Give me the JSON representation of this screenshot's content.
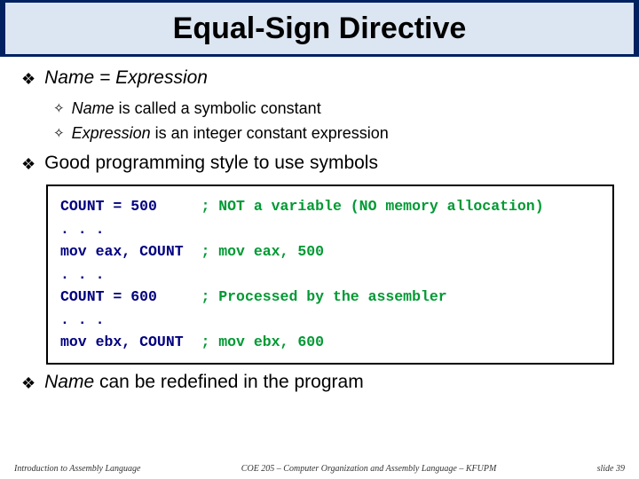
{
  "title": "Equal-Sign Directive",
  "bullets": {
    "b1_prefix": "Name = Expression",
    "b1_sub1_before": "Name",
    "b1_sub1_after": " is called a symbolic constant",
    "b1_sub2_before": "Expression",
    "b1_sub2_after": " is an integer constant expression",
    "b2": "Good programming style to use symbols",
    "b3_before": "Name",
    "b3_after": " can be redefined in the program"
  },
  "code": {
    "l1a": "COUNT = 500     ",
    "l1b": "; NOT a variable (NO memory allocation)",
    "l2": ". . .",
    "l3a": "mov eax, COUNT  ",
    "l3b": "; mov eax, 500",
    "l4": ". . .",
    "l5a": "COUNT = 600     ",
    "l5b": "; Processed by the assembler",
    "l6": ". . .",
    "l7a": "mov ebx, COUNT  ",
    "l7b": "; mov ebx, 600"
  },
  "footer": {
    "left": "Introduction to Assembly Language",
    "center": "COE 205 – Computer Organization and Assembly Language – KFUPM",
    "right": "slide 39"
  }
}
